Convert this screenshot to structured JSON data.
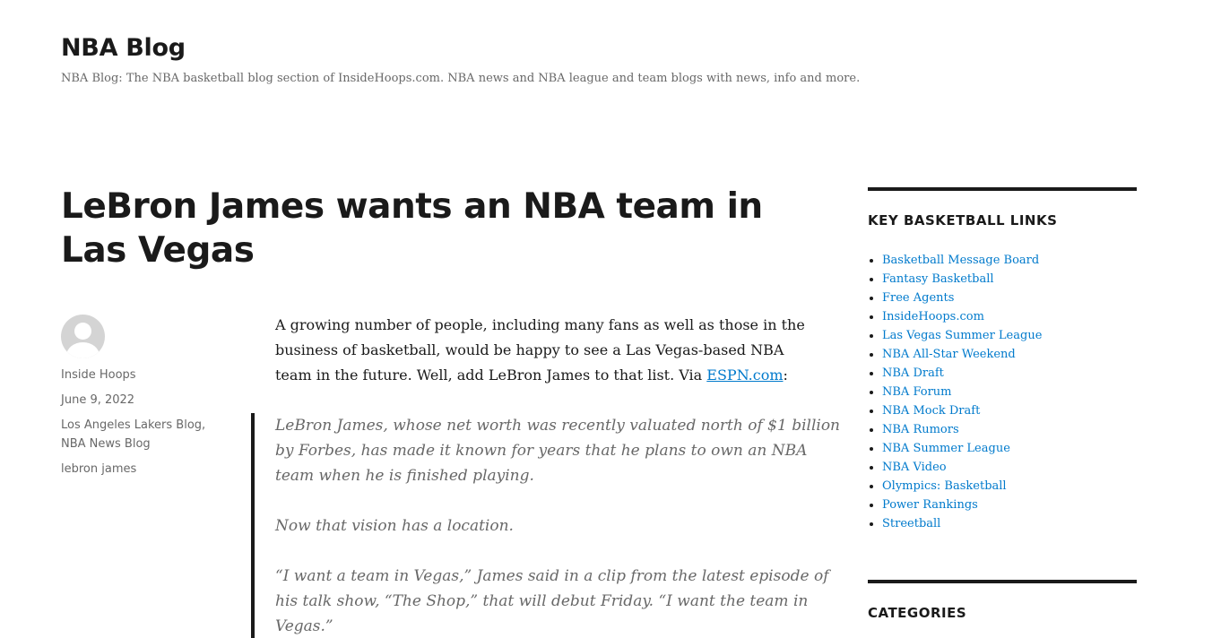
{
  "site": {
    "title": "NBA Blog",
    "description": "NBA Blog: The NBA basketball blog section of InsideHoops.com. NBA news and NBA league and team blogs with news, info and more."
  },
  "post": {
    "title": "LeBron James wants an NBA team in Las Vegas",
    "meta": {
      "author": "Inside Hoops",
      "date": "June 9, 2022",
      "categories": [
        "Los Angeles Lakers Blog",
        "NBA News Blog"
      ],
      "category_separator": ",",
      "tag": "lebron james"
    },
    "intro": {
      "text": "A growing number of people, including many fans as well as those in the business of basketball, would be happy to see a Las Vegas-based NBA team in the future. Well, add LeBron James to that list. Via ",
      "link_text": "ESPN.com",
      "suffix": ":"
    },
    "quote": [
      "LeBron James, whose net worth was recently valuated north of $1 billion by Forbes, has made it known for years that he plans to own an NBA team when he is finished playing.",
      "Now that vision has a location.",
      "“I want a team in Vegas,” James said in a clip from the latest episode of his talk show, “The Shop,” that will debut Friday. “I want the team in Vegas.”"
    ]
  },
  "sidebar": {
    "links_widget": {
      "title": "KEY BASKETBALL LINKS",
      "items": [
        "Basketball Message Board",
        "Fantasy Basketball",
        "Free Agents",
        "InsideHoops.com",
        "Las Vegas Summer League",
        "NBA All-Star Weekend",
        "NBA Draft",
        "NBA Forum",
        "NBA Mock Draft",
        "NBA Rumors",
        "NBA Summer League",
        "NBA Video",
        "Olympics: Basketball",
        "Power Rankings",
        "Streetball"
      ]
    },
    "categories_widget": {
      "title": "CATEGORIES"
    }
  },
  "colors": {
    "link": "#007acc",
    "text": "#1a1a1a",
    "muted": "#686868",
    "avatar_bg": "#d4d4d4"
  }
}
